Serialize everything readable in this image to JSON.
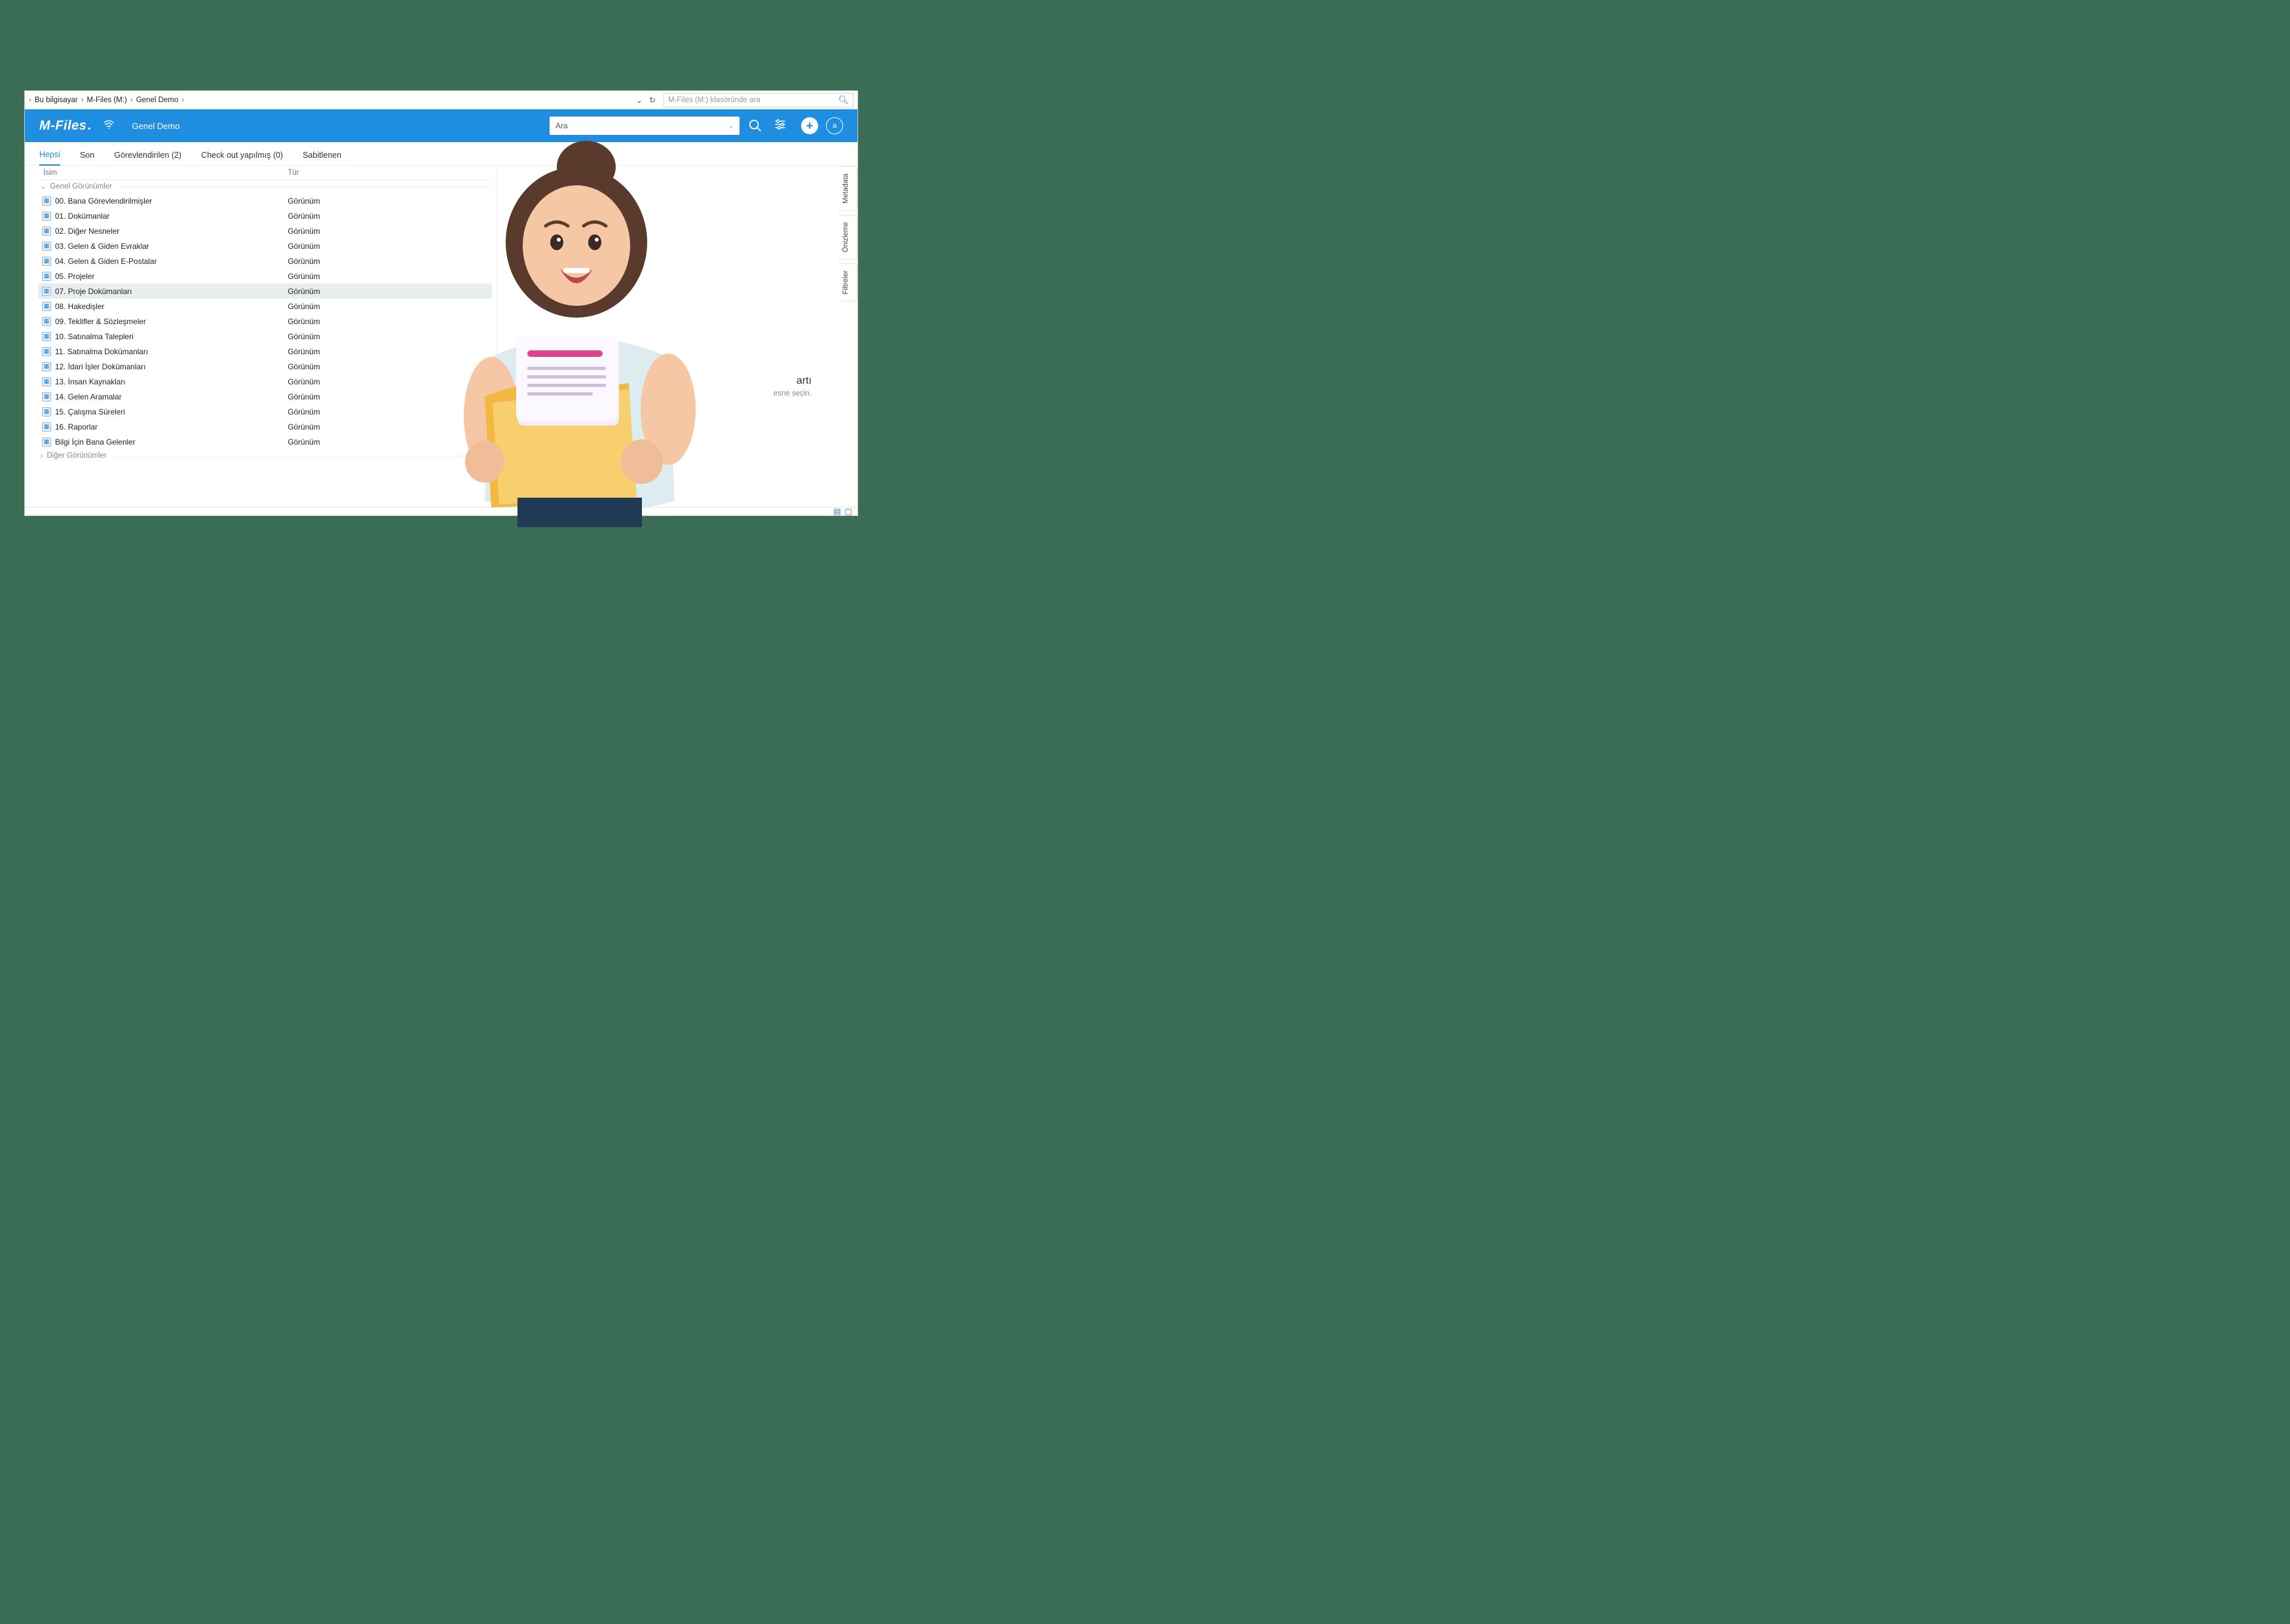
{
  "breadcrumb": {
    "items": [
      "Bu bilgisayar",
      "M-Files (M:)",
      "Genel Demo"
    ]
  },
  "explorer_search": {
    "placeholder": "M-Files (M:) klasöründe ara"
  },
  "header": {
    "brand": "M-Files",
    "vault": "Genel Demo",
    "search_placeholder": "Ara",
    "avatar_initial": "a"
  },
  "tabs": [
    {
      "label": "Hepsi",
      "active": true
    },
    {
      "label": "Son"
    },
    {
      "label": "Görevlendirilen (2)"
    },
    {
      "label": "Check out yapılmış (0)"
    },
    {
      "label": "Sabitlenen"
    }
  ],
  "columns": {
    "name": "İsim",
    "type": "Tür"
  },
  "groups": {
    "main": "Genel Görünümler",
    "other": "Diğer Görünümler"
  },
  "type_label": "Görünüm",
  "items": [
    {
      "name": "00. Bana Görevlendirilmişler"
    },
    {
      "name": "01. Dokümanlar"
    },
    {
      "name": "02. Diğer Nesneler"
    },
    {
      "name": "03. Gelen & Giden Evraklar"
    },
    {
      "name": "04. Gelen & Giden E-Postalar"
    },
    {
      "name": "05. Projeler"
    },
    {
      "name": "07. Proje Dokümanları",
      "selected": true
    },
    {
      "name": "08. Hakedişler"
    },
    {
      "name": "09. Teklifler & Sözleşmeler"
    },
    {
      "name": "10. Satınalma Talepleri"
    },
    {
      "name": "11. Satınalma Dokümanları"
    },
    {
      "name": "12. İdari İşler Dokümanları"
    },
    {
      "name": "13. İnsan Kaynakları"
    },
    {
      "name": "14. Gelen Aramalar"
    },
    {
      "name": "15. Çalışma Süreleri"
    },
    {
      "name": "16. Raporlar"
    },
    {
      "name": "Bilgi İçin Bana Gelenler"
    }
  ],
  "sidetabs": [
    "Metadata",
    "Önizleme",
    "Filtreler"
  ],
  "detail": {
    "title": "artı",
    "subtitle": "esne seçin."
  }
}
